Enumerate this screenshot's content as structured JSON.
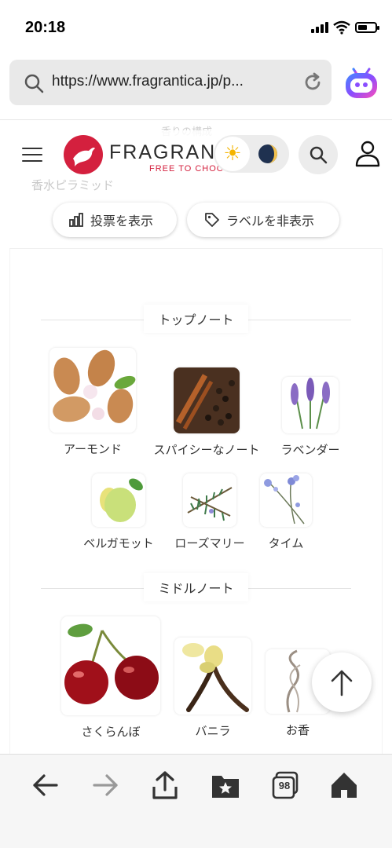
{
  "status_bar": {
    "time": "20:18"
  },
  "browser": {
    "url": "https://www.fragrantica.jp/p...",
    "tab_count": "98"
  },
  "faint": {
    "pyramid_title": "香りの構成",
    "pyramid_label": "香水ピラミッド"
  },
  "site": {
    "logo_text": "FRAGRANTICA",
    "logo_tagline": "FREE TO CHOOSE"
  },
  "actions": {
    "show_votes": "投票を表示",
    "hide_labels": "ラベルを非表示"
  },
  "sections": {
    "top": {
      "title": "トップノート",
      "notes": [
        "アーモンド",
        "スパイシーなノート",
        "ラベンダー",
        "ベルガモット",
        "ローズマリー",
        "タイム"
      ]
    },
    "middle": {
      "title": "ミドルノート",
      "notes": [
        "さくらんぼ",
        "バニラ",
        "お香"
      ]
    }
  },
  "colors": {
    "brand": "#d4203e",
    "sun": "#f4b400"
  }
}
